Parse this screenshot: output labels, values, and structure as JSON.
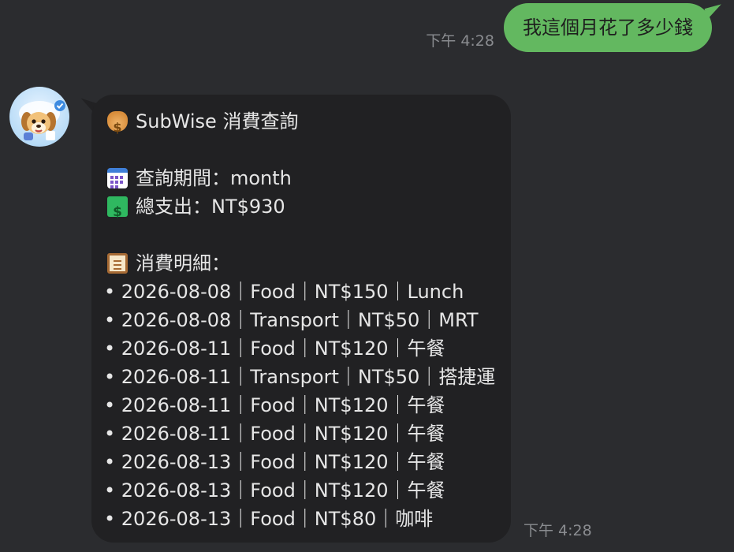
{
  "outgoing": {
    "time": "下午 4:28",
    "text": "我這個月花了多少錢"
  },
  "incoming": {
    "time": "下午 4:28",
    "avatar_icon": "dog-mascot-icon",
    "title": "SubWise 消費查詢",
    "period_line": "查詢期間：month",
    "total_line": "總支出：NT$930",
    "details_header": "消費明細：",
    "icons": {
      "title": "money-bag-icon",
      "period": "calendar-icon",
      "total": "dollar-banknote-icon",
      "details": "clipboard-icon"
    },
    "items": [
      "• 2026-08-08｜Food｜NT$150｜Lunch",
      "• 2026-08-08｜Transport｜NT$50｜MRT",
      "• 2026-08-11｜Food｜NT$120｜午餐",
      "• 2026-08-11｜Transport｜NT$50｜搭捷運",
      "• 2026-08-11｜Food｜NT$120｜午餐",
      "• 2026-08-11｜Food｜NT$120｜午餐",
      "• 2026-08-13｜Food｜NT$120｜午餐",
      "• 2026-08-13｜Food｜NT$120｜午餐",
      "• 2026-08-13｜Food｜NT$80｜咖啡"
    ]
  },
  "colors": {
    "background": "#2b2c2f",
    "outgoing_bubble": "#63b860",
    "incoming_bubble": "#212123",
    "timestamp": "#8a8c90"
  }
}
